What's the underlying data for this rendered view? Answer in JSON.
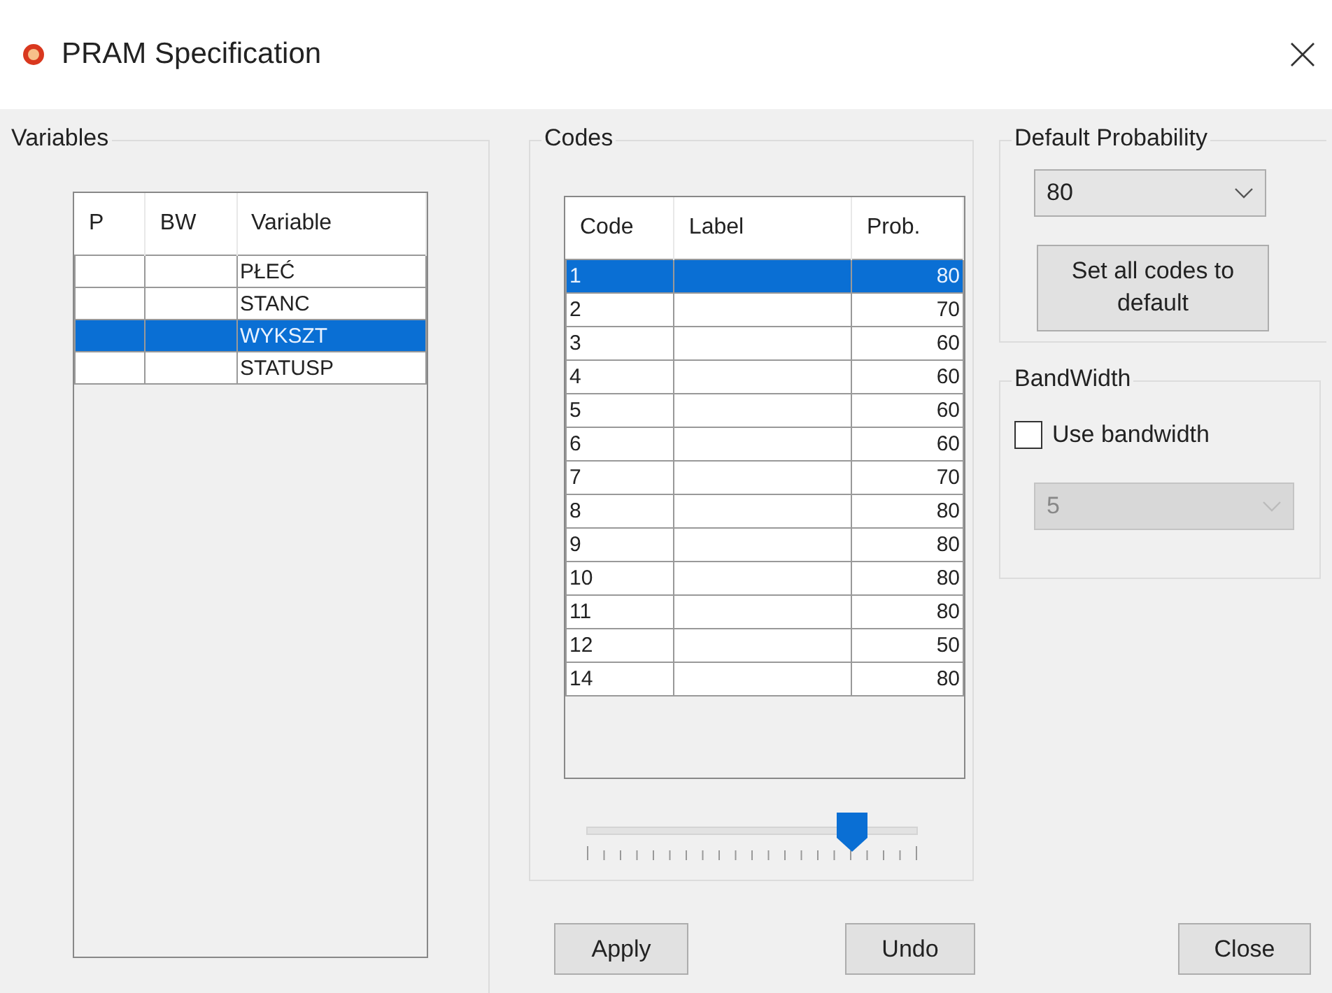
{
  "window": {
    "title": "PRAM Specification"
  },
  "variables": {
    "title": "Variables",
    "columns": [
      "P",
      "BW",
      "Variable"
    ],
    "rows": [
      {
        "p": "",
        "bw": "",
        "variable": "PŁEĆ",
        "selected": false
      },
      {
        "p": "",
        "bw": "",
        "variable": "STANC",
        "selected": false
      },
      {
        "p": "",
        "bw": "",
        "variable": "WYKSZT",
        "selected": true
      },
      {
        "p": "",
        "bw": "",
        "variable": "STATUSP",
        "selected": false
      }
    ]
  },
  "codes": {
    "title": "Codes",
    "columns": [
      "Code",
      "Label",
      "Prob."
    ],
    "rows": [
      {
        "code": "1",
        "prob": "80",
        "selected": true
      },
      {
        "code": "2",
        "prob": "70",
        "selected": false
      },
      {
        "code": "3",
        "prob": "60",
        "selected": false
      },
      {
        "code": "4",
        "prob": "60",
        "selected": false
      },
      {
        "code": "5",
        "prob": "60",
        "selected": false
      },
      {
        "code": "6",
        "prob": "60",
        "selected": false
      },
      {
        "code": "7",
        "prob": "70",
        "selected": false
      },
      {
        "code": "8",
        "prob": "80",
        "selected": false
      },
      {
        "code": "9",
        "prob": "80",
        "selected": false
      },
      {
        "code": "10",
        "prob": "80",
        "selected": false
      },
      {
        "code": "11",
        "prob": "80",
        "selected": false
      },
      {
        "code": "12",
        "prob": "50",
        "selected": false
      },
      {
        "code": "14",
        "prob": "80",
        "selected": false
      }
    ],
    "slider": {
      "level": 0.8
    }
  },
  "default_probability": {
    "title": "Default Probability",
    "value": "80",
    "button": "Set all codes to default"
  },
  "bandwidth": {
    "title": "BandWidth",
    "checkbox": {
      "label": "Use bandwidth",
      "checked": false
    },
    "select": {
      "value": "5",
      "disabled": true
    }
  },
  "buttons": [
    "Apply",
    "Undo",
    "Close"
  ]
}
